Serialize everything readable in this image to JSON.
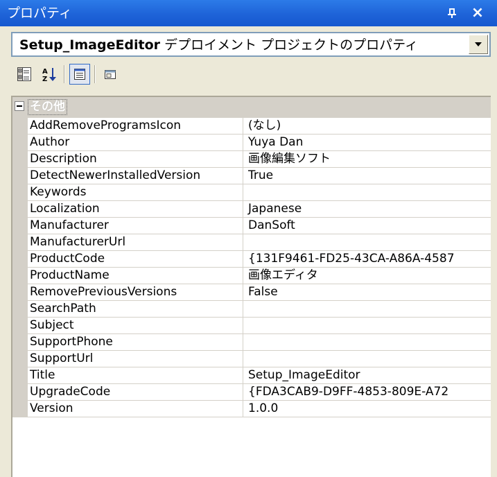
{
  "window": {
    "title": "プロパティ",
    "pin_icon": "pin-icon",
    "close_icon": "close-icon",
    "close_glyph": "×"
  },
  "object_selector": {
    "object_name": "Setup_ImageEditor",
    "object_type": " デプロイメント プロジェクトのプロパティ",
    "dropdown_icon": "chevron-down-icon"
  },
  "toolbar": {
    "buttons": [
      {
        "name": "categorized-view",
        "icon": "categorized-icon",
        "active": false
      },
      {
        "name": "alphabetical-view",
        "icon": "sort-az-icon",
        "active": false
      },
      {
        "name": "properties-view",
        "icon": "properties-icon",
        "active": true
      },
      {
        "name": "property-pages",
        "icon": "property-pages-icon",
        "active": false
      }
    ]
  },
  "grid": {
    "category_label": "その他",
    "properties": [
      {
        "name": "AddRemoveProgramsIcon",
        "value": "(なし)"
      },
      {
        "name": "Author",
        "value": "Yuya Dan"
      },
      {
        "name": "Description",
        "value": "画像編集ソフト"
      },
      {
        "name": "DetectNewerInstalledVersion",
        "value": "True"
      },
      {
        "name": "Keywords",
        "value": ""
      },
      {
        "name": "Localization",
        "value": "Japanese"
      },
      {
        "name": "Manufacturer",
        "value": "DanSoft"
      },
      {
        "name": "ManufacturerUrl",
        "value": ""
      },
      {
        "name": "ProductCode",
        "value": "{131F9461-FD25-43CA-A86A-4587"
      },
      {
        "name": "ProductName",
        "value": "画像エディタ"
      },
      {
        "name": "RemovePreviousVersions",
        "value": "False"
      },
      {
        "name": "SearchPath",
        "value": ""
      },
      {
        "name": "Subject",
        "value": ""
      },
      {
        "name": "SupportPhone",
        "value": ""
      },
      {
        "name": "SupportUrl",
        "value": ""
      },
      {
        "name": "Title",
        "value": "Setup_ImageEditor"
      },
      {
        "name": "UpgradeCode",
        "value": "{FDA3CAB9-D9FF-4853-809E-A72"
      },
      {
        "name": "Version",
        "value": "1.0.0"
      }
    ]
  },
  "colors": {
    "titlebar": "#1E63D8",
    "window_bg": "#ECE9D8",
    "grid_line": "#D4D0C8",
    "active_border": "#316AC5"
  }
}
